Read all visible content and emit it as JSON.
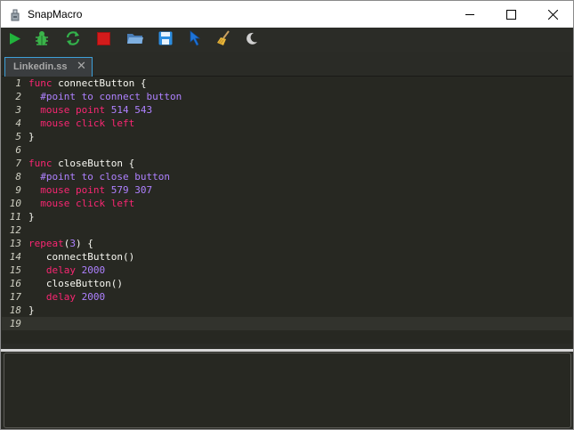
{
  "window": {
    "title": "SnapMacro",
    "minimize_icon": "minimize-icon",
    "maximize_icon": "maximize-icon",
    "close_icon": "close-icon"
  },
  "toolbar": {
    "tools": [
      {
        "name": "run-icon",
        "color": "#1fa83a"
      },
      {
        "name": "debug-icon",
        "color": "#2ea83a"
      },
      {
        "name": "refresh-icon",
        "color": "#2ea83a"
      },
      {
        "name": "stop-icon",
        "color": "#d21a1a"
      },
      {
        "name": "open-folder-icon",
        "color": "#5b8fc7"
      },
      {
        "name": "save-icon",
        "color": "#2f8fe0"
      },
      {
        "name": "pointer-icon",
        "color": "#1e6fd6"
      },
      {
        "name": "broom-icon",
        "color": "#e0a62a"
      },
      {
        "name": "moon-icon",
        "color": "#cfcfcf"
      }
    ]
  },
  "editor": {
    "tab": {
      "label": "Linkedin.ss",
      "close": "✕"
    },
    "lines": [
      {
        "n": "1",
        "parts": [
          [
            "kw",
            "func"
          ],
          [
            "fn",
            " connectButton {"
          ]
        ]
      },
      {
        "n": "2",
        "parts": [
          [
            "fn",
            "  "
          ],
          [
            "cmt",
            "#point to connect button"
          ]
        ]
      },
      {
        "n": "3",
        "parts": [
          [
            "fn",
            "  "
          ],
          [
            "kw",
            "mouse point "
          ],
          [
            "num",
            "514 543"
          ]
        ]
      },
      {
        "n": "4",
        "parts": [
          [
            "fn",
            "  "
          ],
          [
            "kw",
            "mouse click left"
          ]
        ]
      },
      {
        "n": "5",
        "parts": [
          [
            "fn",
            "}"
          ]
        ]
      },
      {
        "n": "6",
        "parts": []
      },
      {
        "n": "7",
        "parts": [
          [
            "kw",
            "func"
          ],
          [
            "fn",
            " closeButton {"
          ]
        ]
      },
      {
        "n": "8",
        "parts": [
          [
            "fn",
            "  "
          ],
          [
            "cmt",
            "#point to close button"
          ]
        ]
      },
      {
        "n": "9",
        "parts": [
          [
            "fn",
            "  "
          ],
          [
            "kw",
            "mouse point "
          ],
          [
            "num",
            "579 307"
          ]
        ]
      },
      {
        "n": "10",
        "parts": [
          [
            "fn",
            "  "
          ],
          [
            "kw",
            "mouse click left"
          ]
        ]
      },
      {
        "n": "11",
        "parts": [
          [
            "fn",
            "}"
          ]
        ]
      },
      {
        "n": "12",
        "parts": []
      },
      {
        "n": "13",
        "parts": [
          [
            "kw",
            "repeat"
          ],
          [
            "fn",
            "("
          ],
          [
            "num",
            "3"
          ],
          [
            "fn",
            ") {"
          ]
        ]
      },
      {
        "n": "14",
        "parts": [
          [
            "fn",
            "   connectButton()"
          ]
        ]
      },
      {
        "n": "15",
        "parts": [
          [
            "fn",
            "   "
          ],
          [
            "kw",
            "delay "
          ],
          [
            "num",
            "2000"
          ]
        ]
      },
      {
        "n": "16",
        "parts": [
          [
            "fn",
            "   closeButton()"
          ]
        ]
      },
      {
        "n": "17",
        "parts": [
          [
            "fn",
            "   "
          ],
          [
            "kw",
            "delay "
          ],
          [
            "num",
            "2000"
          ]
        ]
      },
      {
        "n": "18",
        "parts": [
          [
            "fn",
            "}"
          ]
        ]
      },
      {
        "n": "19",
        "parts": [],
        "active": true
      }
    ]
  },
  "output": {
    "text": ""
  }
}
